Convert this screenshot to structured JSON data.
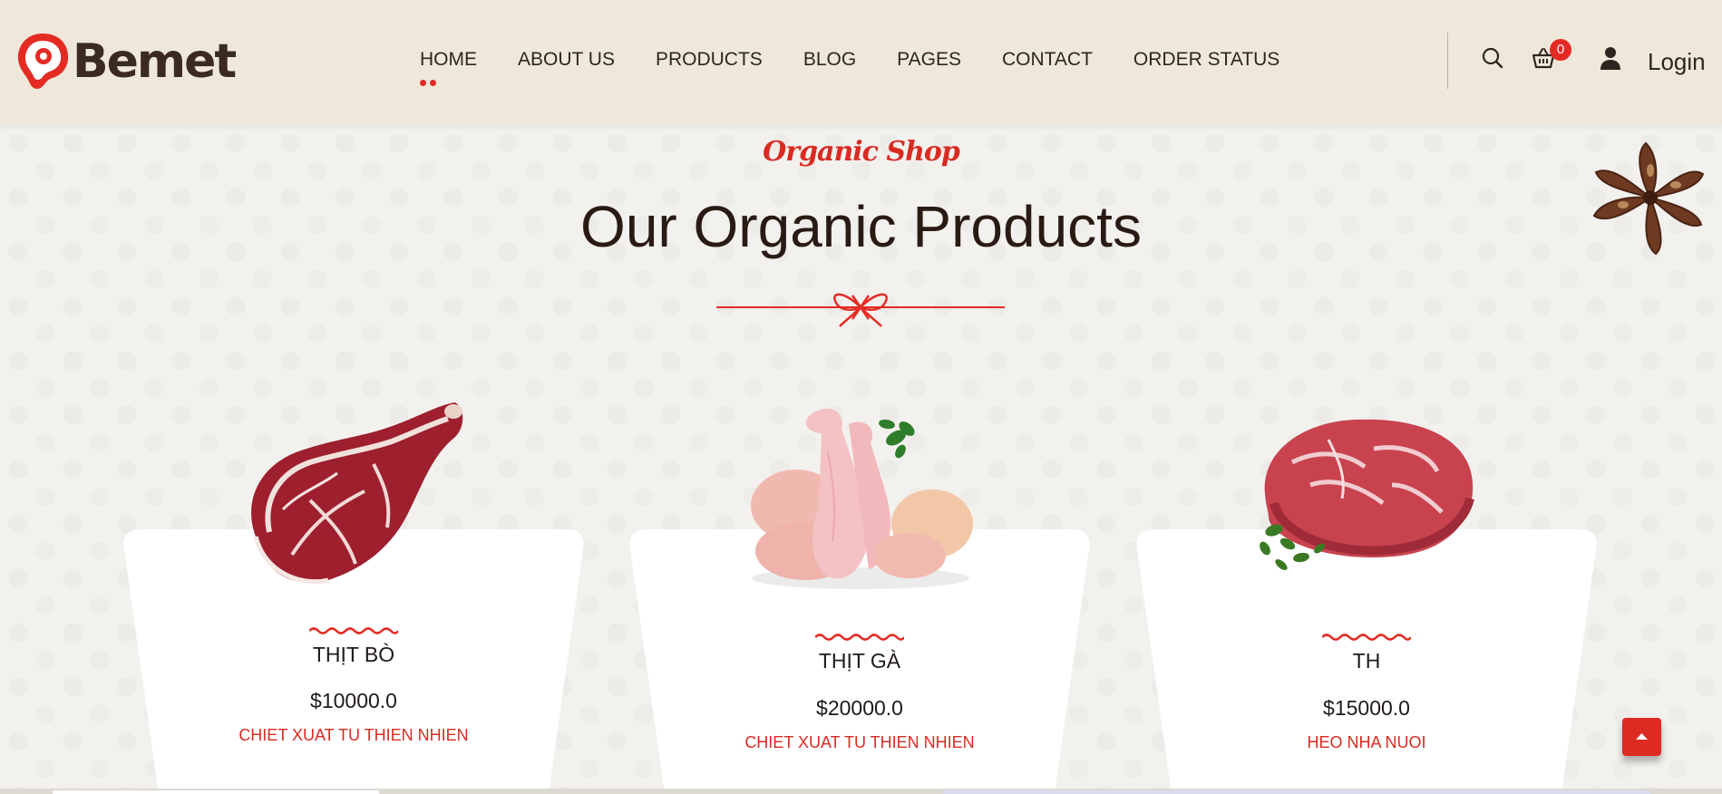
{
  "brand": {
    "name": "Bemet",
    "accent": "#e32b24"
  },
  "nav": {
    "items": [
      {
        "label": "HOME",
        "active": true
      },
      {
        "label": "ABOUT US"
      },
      {
        "label": "PRODUCTS"
      },
      {
        "label": "BLOG"
      },
      {
        "label": "PAGES"
      },
      {
        "label": "CONTACT"
      },
      {
        "label": "ORDER STATUS"
      }
    ]
  },
  "header": {
    "icons": [
      "search-icon",
      "cart-icon",
      "user-icon"
    ],
    "cart_count": "0",
    "login_label": "Login"
  },
  "section": {
    "subtitle": "Organic Shop",
    "title": "Our Organic Products"
  },
  "products": [
    {
      "name": "THỊT BÒ",
      "price": "$10000.0",
      "description": "CHIET XUAT TU THIEN NHIEN",
      "image": "beef-steak"
    },
    {
      "name": "THỊT GÀ",
      "price": "$20000.0",
      "description": "CHIET XUAT TU THIEN NHIEN",
      "image": "chicken-drumsticks"
    },
    {
      "name": "TH",
      "price": "$15000.0",
      "description": "HEO NHA NUOI",
      "image": "pork-steak"
    }
  ]
}
